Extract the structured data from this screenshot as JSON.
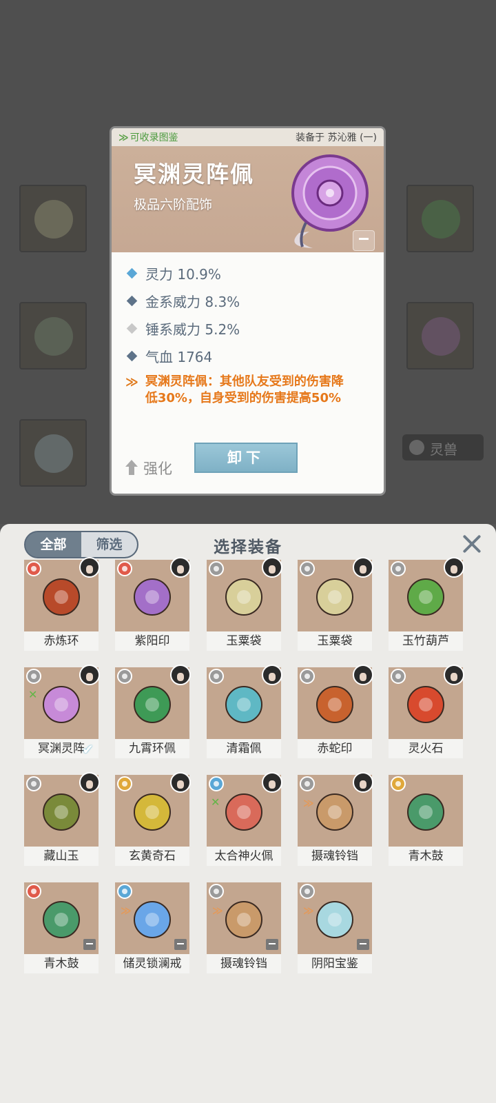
{
  "detail": {
    "collectible_label": "可收录图鉴",
    "equipped_to": "装备于 苏沁雅 (一)",
    "name": "冥渊灵阵佩",
    "subtitle": "极品六阶配饰",
    "stats": [
      {
        "text": "灵力 10.9%",
        "marker_color": "#5aa7d6"
      },
      {
        "text": "金系威力 8.3%",
        "marker_color": "#5e7389"
      },
      {
        "text": "锤系威力 5.2%",
        "marker_color": "#c8c8c8"
      },
      {
        "text": "气血 1764",
        "marker_color": "#5e7389"
      }
    ],
    "effect_line1": "冥渊灵阵佩：其他队友受到的伤害降",
    "effect_line2": "低30%，自身受到的伤害提高50%",
    "upgrade_label": "强化",
    "unequip_label": "卸下"
  },
  "background": {
    "beast_label": "灵兽"
  },
  "panel": {
    "tab_all": "全部",
    "tab_filter": "筛选",
    "title": "选择装备",
    "items": [
      {
        "name": "赤炼环",
        "color": "#b84a2a"
      },
      {
        "name": "紫阳印",
        "color": "#a36fc8"
      },
      {
        "name": "玉粟袋",
        "color": "#d8cf9a"
      },
      {
        "name": "玉粟袋",
        "color": "#d8cf9a"
      },
      {
        "name": "玉竹葫芦",
        "color": "#5faa48"
      },
      {
        "name": "冥渊灵阵",
        "color": "#c78ad8"
      },
      {
        "name": "九霄环佩",
        "color": "#3e9a56"
      },
      {
        "name": "清霜佩",
        "color": "#5fb8c4"
      },
      {
        "name": "赤蛇印",
        "color": "#c8622e"
      },
      {
        "name": "灵火石",
        "color": "#d84a2e"
      },
      {
        "name": "藏山玉",
        "color": "#7a8a3a"
      },
      {
        "name": "玄黄奇石",
        "color": "#d4b83a"
      },
      {
        "name": "太合神火佩",
        "color": "#d96a5a"
      },
      {
        "name": "摄魂铃铛",
        "color": "#c99a6a"
      },
      {
        "name": "青木鼓",
        "color": "#4a9a6a"
      },
      {
        "name": "青木鼓",
        "color": "#4a9a6a"
      },
      {
        "name": "储灵锁澜戒",
        "color": "#6aa6e8"
      },
      {
        "name": "摄魂铃铛",
        "color": "#c99a6a"
      },
      {
        "name": "阴阳宝鉴",
        "color": "#a8d8e0"
      }
    ]
  }
}
